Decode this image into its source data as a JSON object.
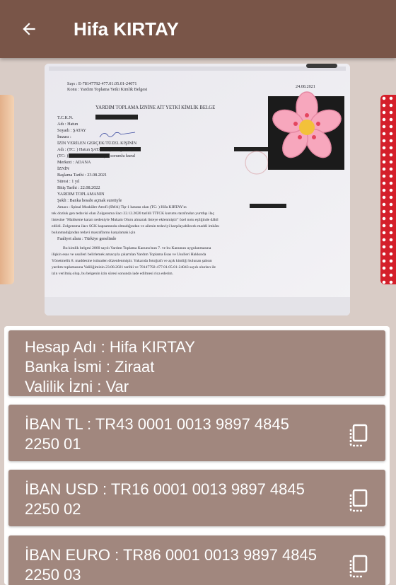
{
  "header": {
    "title": "Hifa KIRTAY"
  },
  "document": {
    "ref_line": "Sayı : E-78147792-477.01.05.01-24071",
    "subject_line": "Konu : Yardım Toplama Yetki Kimlik Belgesi",
    "date": "24.08.2021",
    "heading": "YARDIM TOPLAMA İZNİNE AİT YETKİ KİMLİK BELGE",
    "tckn_label": "T.C.K.N.",
    "adi_line": "Adı              : Hatun",
    "soyadi_line": "Soyadı          : ŞATAY",
    "imzasi_line": "İmzası          :",
    "izin_heading": "İZİN VERİLEN GERÇEK/TÜZEL KİŞİNİN",
    "izin_adi": "Adı       : (TC:               ) Hatun ŞATAY başkanlığında (TC:",
    "izin_tc": "(TC:                  ) Fatma GÖK'ten oluşan sorumlu kurul",
    "merkezi": "Merkezi  : ADANA",
    "izin_label": "İZNİN",
    "baslama": "Başlama Tarihi  : 23.08.2021",
    "suresi": "Süresi             : 1 yıl",
    "bitis": "Bitiş Tarihi      : 22.08.2022",
    "yardim_heading": "YARDIM TOPLAMANIN",
    "sekli": "Şekli            : Banka hesabı açmak suretiyle",
    "amaci": "Amacı         : Spinal Musküler Atrofi (SMA) Tip-1 hastası olan (TC:            ) Hifa KIRTAY'ın",
    "amaci_2": "tek dozluk gen tedavisi olan Zolgensma ilacı 22.12.2020 tarihli TİTCK kurumu tarafından yurtdışı ilaç",
    "amaci_3": "listesine \"Mahkeme kararı nedeniyle Mukam Oluru alınarak listeye eklenmiştir\" özel notu eşliğinde dâhil",
    "amaci_4": "edildi. Zolgensma ilacı SGK kapsamında olmadığından ve ailenin tedaviyi karşılayabilecek maddi imkânı",
    "amaci_5": "bulunmadığından tedavi masraflarını karşılamak için",
    "faaliyet": "Faaliyet alanı   : Türkiye genelinde",
    "body_1": "Bu kimlik belgesi 2860 sayılı Yardım Toplama Kanunu'nun 7. ve bu Kanunun uygulanmasına",
    "body_2": "ilişkin esas ve usulleri belirlemek amacıyla çıkartılan Yardım Toplama Esas ve Usulleri Hakkında",
    "body_3": "Yönetmelik 8. maddesine istinaden düzenlenmiştir. Yukarıda fotoğrafı ve açık kimliği bulunan şahsın",
    "body_4": "yardım toplamasına Valiliğimizin 23.08.2021 tarihli ve 78147792-477.01.05.01-24043 sayılı olurları ile",
    "body_5": "izin verilmiş olup, bu belgenin izin süresi sonunda iade edilmesi rica ederim."
  },
  "account": {
    "hesap_adi": "Hesap Adı : Hifa KIRTAY",
    "banka": "Banka İsmi : Ziraat",
    "valilik": "Valilik İzni : Var"
  },
  "ibans": [
    {
      "line1": "İBAN TL : TR43 0001 0013 9897 4845",
      "line2": "2250 01"
    },
    {
      "line1": "İBAN USD : TR16 0001 0013 9897 4845",
      "line2": "2250 02"
    },
    {
      "line1": "İBAN EURO : TR86 0001 0013 9897 4845",
      "line2": "2250 03"
    }
  ],
  "colors": {
    "appbar": "#795548",
    "card": "#a1877e",
    "background": "#d9ccc6"
  },
  "icons": {
    "back": "arrow-back-icon",
    "copy": "copy-icon"
  }
}
